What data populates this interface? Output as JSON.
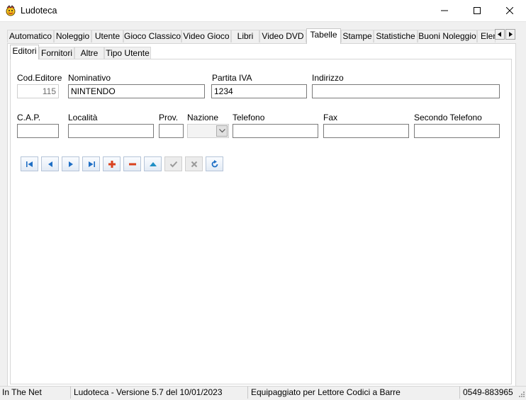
{
  "window": {
    "title": "Ludoteca"
  },
  "main_tabs": [
    {
      "label": "Automatico"
    },
    {
      "label": "Noleggio"
    },
    {
      "label": "Utente"
    },
    {
      "label": "Gioco Classico"
    },
    {
      "label": "Video Gioco"
    },
    {
      "label": "Libri"
    },
    {
      "label": "Video DVD"
    },
    {
      "label": "Tabelle"
    },
    {
      "label": "Stampe"
    },
    {
      "label": "Statistiche"
    },
    {
      "label": "Buoni Noleggio"
    },
    {
      "label": "Elen"
    }
  ],
  "sub_tabs": [
    {
      "label": "Editori"
    },
    {
      "label": "Fornitori"
    },
    {
      "label": "Altre"
    },
    {
      "label": "Tipo Utente"
    }
  ],
  "form": {
    "cod_editore": {
      "label": "Cod.Editore",
      "value": "115"
    },
    "nominativo": {
      "label": "Nominativo",
      "value": "NINTENDO"
    },
    "partita_iva": {
      "label": "Partita IVA",
      "value": "1234"
    },
    "indirizzo": {
      "label": "Indirizzo",
      "value": ""
    },
    "cap": {
      "label": "C.A.P.",
      "value": ""
    },
    "localita": {
      "label": "Località",
      "value": ""
    },
    "prov": {
      "label": "Prov.",
      "value": ""
    },
    "nazione": {
      "label": "Nazione",
      "value": ""
    },
    "telefono": {
      "label": "Telefono",
      "value": ""
    },
    "fax": {
      "label": "Fax",
      "value": ""
    },
    "secondo_telefono": {
      "label": "Secondo Telefono",
      "value": ""
    }
  },
  "navigator_icons": [
    "first-icon",
    "prior-icon",
    "next-icon",
    "last-icon",
    "insert-icon",
    "delete-icon",
    "edit-icon",
    "post-icon",
    "cancel-icon",
    "refresh-icon"
  ],
  "statusbar": {
    "panel1": "In The Net",
    "panel2": "Ludoteca - Versione 5.7 del 10/01/2023",
    "panel3": "Equipaggiato per Lettore Codici a Barre",
    "panel4": "0549-883965"
  },
  "colors": {
    "nav_blue": "#1f6fc5",
    "nav_red": "#d9411e",
    "nav_gray": "#9a9a9a"
  }
}
